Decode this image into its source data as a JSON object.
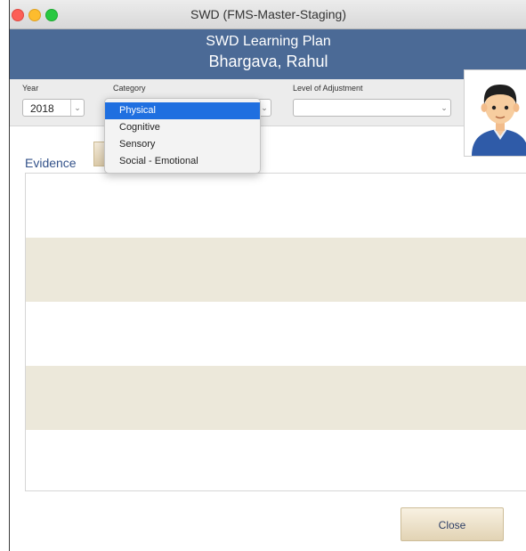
{
  "window": {
    "title": "SWD (FMS-Master-Staging)"
  },
  "header": {
    "title": "SWD Learning Plan",
    "student_name": "Bhargava, Rahul"
  },
  "filters": {
    "year_label": "Year",
    "year_value": "2018",
    "category_label": "Category",
    "category_options": [
      "Physical",
      "Cognitive",
      "Sensory",
      "Social - Emotional"
    ],
    "selected_category": "Physical",
    "level_label": "Level of Adjustment",
    "level_value": ""
  },
  "evidence": {
    "label": "Evidence",
    "rows": 5
  },
  "buttons": {
    "close_label": "Close"
  },
  "colors": {
    "header_bg": "#4b6a96",
    "row_alt": "#ece8da",
    "selection": "#1f6fe0",
    "evidence_label": "#33528a"
  },
  "icons": [
    "close-window-icon",
    "minimize-window-icon",
    "zoom-window-icon",
    "chevron-down-icon",
    "user-avatar-icon"
  ]
}
